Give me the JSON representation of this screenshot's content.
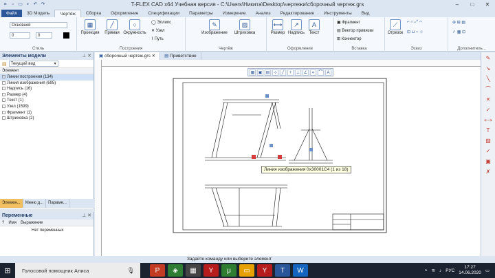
{
  "window": {
    "title": "T-FLEX CAD x64 Учебная версия - C:\\Users\\Никита\\Desktop\\чертежи\\сборочный чертеж.grs"
  },
  "menu_tabs": [
    "Файл",
    "3D Модель",
    "Чертёж",
    "Сборка",
    "Оформление",
    "Спецификации",
    "Параметры",
    "Измерение",
    "Анализ",
    "Редактирование",
    "Инструменты",
    "Вид"
  ],
  "ribbon": {
    "style": {
      "layer": "Основной",
      "val1": "0",
      "val2": "0",
      "label": "Стиль"
    },
    "build": {
      "projection": "Проекция",
      "line": "Прямая",
      "circle": "Окружность",
      "ellipse": "Эллипс",
      "node": "Узел",
      "path": "Путь",
      "label": "Построения"
    },
    "drawing": {
      "image": "Изображение",
      "hatch": "Штриховка",
      "label": "Чертёж"
    },
    "format": {
      "size": "Размер",
      "caption": "Надпись",
      "text": "Текст",
      "label": "Оформление"
    },
    "insert": {
      "fragment": "Фрагмент",
      "bind_vector": "Вектор привязки",
      "connector": "Коннектор",
      "label": "Вставка"
    },
    "sketch": {
      "segment": "Отрезок",
      "label": "Эскиз"
    },
    "extra": {
      "label": "Дополнитель..."
    }
  },
  "model_panel": {
    "title": "Элементы модели",
    "view_select": "Текущий вид",
    "column": "Элемент",
    "items": [
      "Линии построения (134)",
      "Линия изображения (695)",
      "Надпись (16)",
      "Размер (4)",
      "Текст (1)",
      "Узел (1599)",
      "Фрагмент (1)",
      "Штриховка (2)"
    ],
    "tabs": [
      "Элемен...",
      "Меню д...",
      "Параме..."
    ]
  },
  "variables_panel": {
    "title": "Переменные",
    "columns": [
      "?",
      "Имя",
      "Выражение"
    ],
    "empty": "Нет переменных"
  },
  "document_tabs": [
    "сборочный чертеж.grs",
    "Приветствие"
  ],
  "tooltip": "Линия изображения 0x30001C4 (1 из 18)",
  "status": "Задайте команду или выберите элемент",
  "taskbar": {
    "search": "Голосовой помощник Алиса",
    "lang": "РУС",
    "time": "17:27",
    "date": "14.06.2020"
  }
}
